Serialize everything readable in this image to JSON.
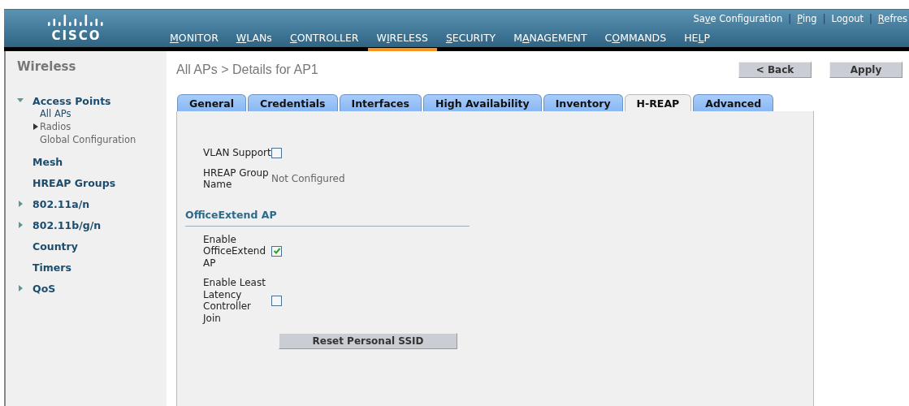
{
  "header": {
    "logo_text": "CISCO",
    "separator": "|",
    "top_links": [
      {
        "pre": "Sa",
        "key": "v",
        "post": "e Configuration"
      },
      {
        "key": "P",
        "post": "ing"
      },
      {
        "pre": "Lo",
        "key": "g",
        "post": "out"
      },
      {
        "key": "R",
        "post": "efres"
      }
    ],
    "menu": [
      {
        "key": "M",
        "post": "ONITOR",
        "selected": false
      },
      {
        "key": "W",
        "post": "LANs",
        "selected": false
      },
      {
        "key": "C",
        "post": "ONTROLLER",
        "selected": false
      },
      {
        "pre": "W",
        "key": "I",
        "post": "RELESS",
        "selected": true
      },
      {
        "key": "S",
        "post": "ECURITY",
        "selected": false
      },
      {
        "pre": "M",
        "key": "A",
        "post": "NAGEMENT",
        "selected": false
      },
      {
        "pre": "C",
        "key": "O",
        "post": "MMANDS",
        "selected": false
      },
      {
        "pre": "HE",
        "key": "L",
        "post": "P",
        "selected": false
      }
    ]
  },
  "sidebar": {
    "title": "Wireless",
    "items": [
      {
        "label": "Access Points",
        "expanded": true,
        "children": [
          {
            "label": "All APs",
            "selected": true
          },
          {
            "label": "Radios",
            "selected": false,
            "expanded": false
          },
          {
            "label": "Global Configuration",
            "selected": false
          }
        ]
      },
      {
        "label": "Mesh"
      },
      {
        "label": "HREAP Groups"
      },
      {
        "label": "802.11a/n",
        "expanded": false
      },
      {
        "label": "802.11b/g/n",
        "expanded": false
      },
      {
        "label": "Country"
      },
      {
        "label": "Timers"
      },
      {
        "label": "QoS",
        "expanded": false
      }
    ]
  },
  "page": {
    "breadcrumb": "All APs > Details for AP1",
    "buttons": [
      "< Back",
      "Apply"
    ]
  },
  "tabs": [
    {
      "label": "General",
      "selected": false
    },
    {
      "label": "Credentials",
      "selected": false
    },
    {
      "label": "Interfaces",
      "selected": false
    },
    {
      "label": "High Availability",
      "selected": false
    },
    {
      "label": "Inventory",
      "selected": false
    },
    {
      "label": "H-REAP",
      "selected": true
    },
    {
      "label": "Advanced",
      "selected": false
    }
  ],
  "form": {
    "fields": [
      {
        "kind": "checkbox",
        "label": "VLAN Support",
        "checked": false
      },
      {
        "kind": "text",
        "label": "HREAP Group Name",
        "value": "Not Configured"
      }
    ],
    "section": {
      "title": "OfficeExtend AP",
      "fields": [
        {
          "kind": "checkbox",
          "label": "Enable OfficeExtend AP",
          "checked": true
        },
        {
          "kind": "checkbox",
          "label": "Enable Least Latency Controller Join",
          "checked": false
        }
      ],
      "button": "Reset Personal SSID"
    }
  }
}
